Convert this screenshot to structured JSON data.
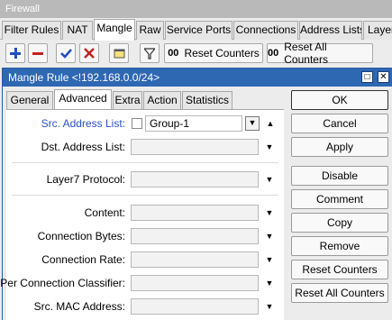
{
  "parent_window": {
    "title": "Firewall",
    "tabs": [
      "Filter Rules",
      "NAT",
      "Mangle",
      "Raw",
      "Service Ports",
      "Connections",
      "Address Lists",
      "Layer"
    ],
    "active_tab": "Mangle"
  },
  "toolbar": {
    "add_icon": "plus-icon",
    "remove_icon": "minus-icon",
    "enable_icon": "check-icon",
    "disable_icon": "x-icon",
    "comment_icon": "note-icon",
    "filter_icon": "filter-icon",
    "counter_prefix": "00",
    "reset_counters": "Reset Counters",
    "reset_all_counters": "Reset All Counters"
  },
  "dialog": {
    "title": "Mangle Rule <!192.168.0.0/24>",
    "restore_glyph": "□",
    "close_glyph": "✕",
    "tabs": [
      "General",
      "Advanced",
      "Extra",
      "Action",
      "Statistics"
    ],
    "active_tab": "Advanced",
    "fields": {
      "src_address_list": {
        "label": "Src. Address List:",
        "value": "Group-1"
      },
      "dst_address_list": {
        "label": "Dst. Address List:",
        "value": ""
      },
      "layer7_protocol": {
        "label": "Layer7 Protocol:",
        "value": ""
      },
      "content": {
        "label": "Content:",
        "value": ""
      },
      "connection_bytes": {
        "label": "Connection Bytes:",
        "value": ""
      },
      "connection_rate": {
        "label": "Connection Rate:",
        "value": ""
      },
      "per_connection_classifier": {
        "label": "Per Connection Classifier:",
        "value": ""
      },
      "src_mac_address": {
        "label": "Src. MAC Address:",
        "value": ""
      }
    },
    "buttons": {
      "ok": "OK",
      "cancel": "Cancel",
      "apply": "Apply",
      "disable": "Disable",
      "comment": "Comment",
      "copy": "Copy",
      "remove": "Remove",
      "reset_counters": "Reset Counters",
      "reset_all_counters": "Reset All Counters"
    }
  },
  "colors": {
    "dialog_title_bg": "#2e67b2",
    "label_blue": "#2b50c8",
    "add_icon": "#1f4fbf",
    "remove_icon": "#c52020",
    "check_icon": "#1f4fbf",
    "x_icon": "#c52020"
  }
}
